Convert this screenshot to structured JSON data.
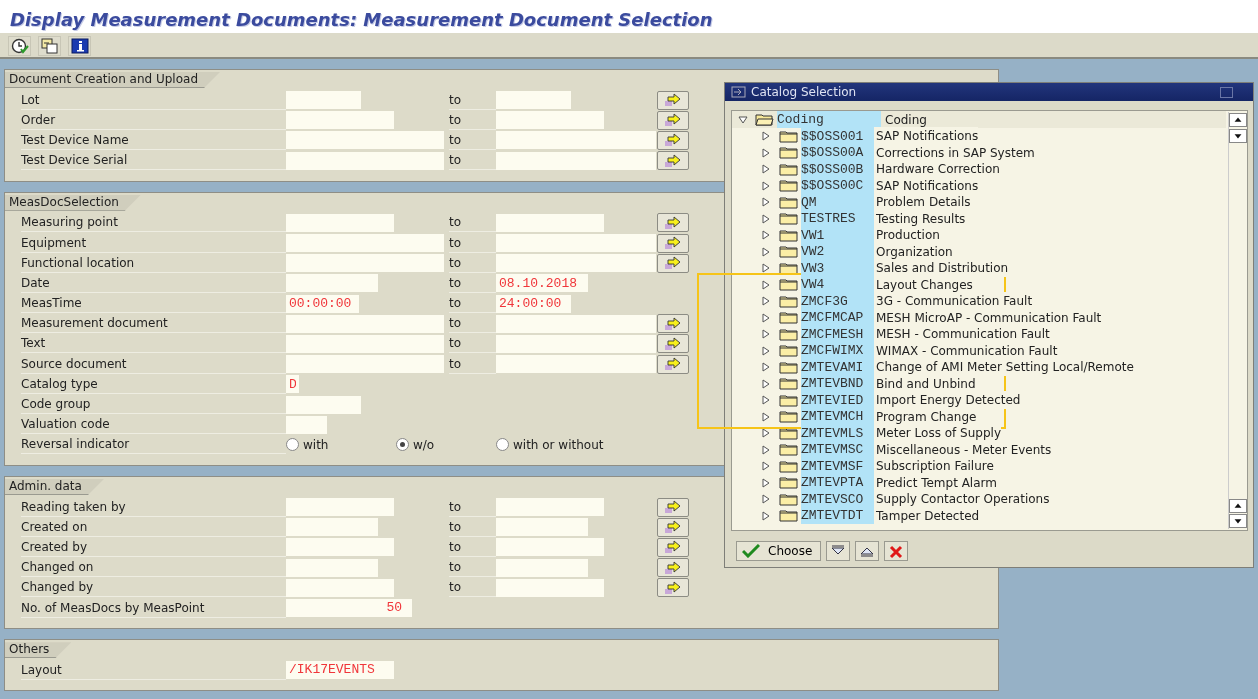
{
  "title": "Display Measurement Documents: Measurement Document Selection",
  "sections": [
    {
      "title": "Document Creation and Upload",
      "rows": [
        {
          "kind": "range",
          "label": "Lot",
          "to_label": "to",
          "multiple_selection": true
        },
        {
          "kind": "range",
          "label": "Order",
          "to_label": "to",
          "multiple_selection": true
        },
        {
          "kind": "range",
          "label": "Test Device Name",
          "to_label": "to",
          "multiple_selection": true
        },
        {
          "kind": "range",
          "label": "Test Device Serial",
          "to_label": "to",
          "multiple_selection": true
        }
      ]
    },
    {
      "title": "MeasDocSelection",
      "rows": [
        {
          "kind": "range",
          "label": "Measuring point",
          "to_label": "to",
          "multiple_selection": true
        },
        {
          "kind": "range",
          "label": "Equipment",
          "to_label": "to",
          "multiple_selection": true
        },
        {
          "kind": "range",
          "label": "Functional location",
          "to_label": "to",
          "multiple_selection": true
        },
        {
          "kind": "range",
          "label": "Date",
          "to_label": "to",
          "value_to": "08.10.2018",
          "multiple_selection": false
        },
        {
          "kind": "range",
          "label": "MeasTime",
          "value": "00:00:00",
          "to_label": "to",
          "value_to": "24:00:00",
          "multiple_selection": false
        },
        {
          "kind": "range",
          "label": "Measurement document",
          "to_label": "to",
          "multiple_selection": true
        },
        {
          "kind": "range",
          "label": "Text",
          "to_label": "to",
          "multiple_selection": true
        },
        {
          "kind": "range",
          "label": "Source document",
          "to_label": "to",
          "multiple_selection": true
        },
        {
          "kind": "single",
          "label": "Catalog type",
          "value": "D"
        },
        {
          "kind": "single",
          "label": "Code group"
        },
        {
          "kind": "single",
          "label": "Valuation code"
        },
        {
          "kind": "radio",
          "label": "Reversal indicator",
          "options": [
            {
              "label": "with",
              "selected": false
            },
            {
              "label": "w/o",
              "selected": true
            },
            {
              "label": "with or without",
              "selected": false
            }
          ]
        }
      ]
    },
    {
      "title": "Admin. data",
      "rows": [
        {
          "kind": "range",
          "label": "Reading taken by",
          "to_label": "to",
          "multiple_selection": true
        },
        {
          "kind": "range",
          "label": "Created on",
          "to_label": "to",
          "multiple_selection": true
        },
        {
          "kind": "range",
          "label": "Created by",
          "to_label": "to",
          "multiple_selection": true
        },
        {
          "kind": "range",
          "label": "Changed on",
          "to_label": "to",
          "multiple_selection": true
        },
        {
          "kind": "range",
          "label": "Changed by",
          "to_label": "to",
          "multiple_selection": true
        },
        {
          "kind": "number",
          "label": "No. of MeasDocs by MeasPoint",
          "value": "50"
        }
      ]
    },
    {
      "title": "Others",
      "rows": [
        {
          "kind": "single",
          "label": "Layout",
          "value": "/IK17EVENTS"
        }
      ]
    }
  ],
  "dialog": {
    "title": "Catalog Selection",
    "root": {
      "code": "Coding",
      "text": "Coding",
      "expanded": true
    },
    "items": [
      {
        "code": "$$OSS001",
        "text": "SAP Notifications",
        "expanded": false
      },
      {
        "code": "$$OSS00A",
        "text": "Corrections in SAP System",
        "expanded": false
      },
      {
        "code": "$$OSS00B",
        "text": "Hardware Correction",
        "expanded": false
      },
      {
        "code": "$$OSS00C",
        "text": "SAP Notifications",
        "expanded": false
      },
      {
        "code": "QM",
        "text": "Problem Details",
        "expanded": false
      },
      {
        "code": "TESTRES",
        "text": "Testing Results",
        "expanded": false
      },
      {
        "code": "VW1",
        "text": "Production",
        "expanded": false
      },
      {
        "code": "VW2",
        "text": "Organization",
        "expanded": false
      },
      {
        "code": "VW3",
        "text": "Sales and Distribution",
        "expanded": false
      },
      {
        "code": "VW4",
        "text": "Layout Changes",
        "expanded": false
      },
      {
        "code": "ZMCF3G",
        "text": "3G - Communication Fault",
        "expanded": false
      },
      {
        "code": "ZMCFMCAP",
        "text": "MESH MicroAP - Communication Fault",
        "expanded": false
      },
      {
        "code": "ZMCFMESH",
        "text": "MESH - Communication Fault",
        "expanded": false
      },
      {
        "code": "ZMCFWIMX",
        "text": "WIMAX - Communication Fault",
        "expanded": false
      },
      {
        "code": "ZMTEVAMI",
        "text": "Change of AMI Meter Setting Local/Remote",
        "expanded": false
      },
      {
        "code": "ZMTEVBND",
        "text": "Bind and Unbind",
        "expanded": false
      },
      {
        "code": "ZMTEVIED",
        "text": "Import Energy Detected",
        "expanded": false
      },
      {
        "code": "ZMTEVMCH",
        "text": "Program Change",
        "expanded": false
      },
      {
        "code": "ZMTEVMLS",
        "text": "Meter Loss of Supply",
        "expanded": false
      },
      {
        "code": "ZMTEVMSC",
        "text": "Miscellaneous - Meter Events",
        "expanded": false
      },
      {
        "code": "ZMTEVMSF",
        "text": "Subscription Failure",
        "expanded": false
      },
      {
        "code": "ZMTEVPTA",
        "text": "Predict Tempt Alarm",
        "expanded": false
      },
      {
        "code": "ZMTEVSCO",
        "text": "Supply Contactor Operations",
        "expanded": false
      },
      {
        "code": "ZMTEVTDT",
        "text": "Tamper Detected",
        "expanded": false
      }
    ],
    "choose_label": "Choose"
  }
}
